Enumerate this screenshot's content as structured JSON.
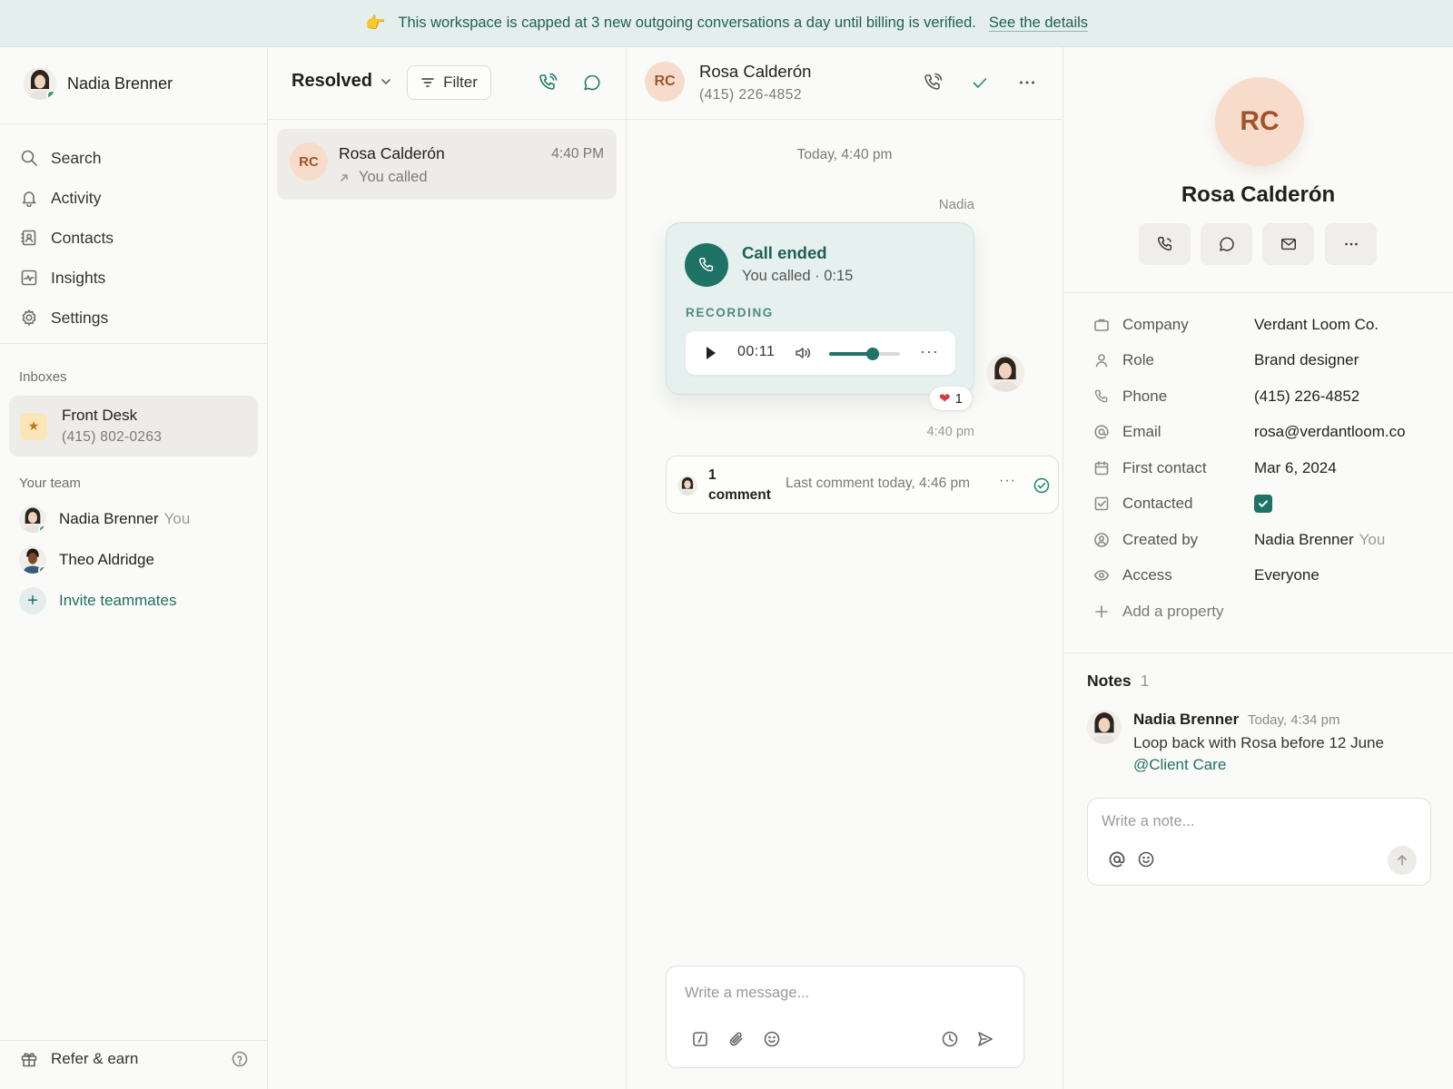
{
  "banner": {
    "emoji": "👉",
    "message": "This workspace is capped at 3 new outgoing conversations a day until billing is verified.",
    "link": "See the details"
  },
  "sidebar": {
    "user_name": "Nadia Brenner",
    "nav": [
      {
        "label": "Search",
        "icon": "search-icon"
      },
      {
        "label": "Activity",
        "icon": "bell-icon"
      },
      {
        "label": "Contacts",
        "icon": "contacts-icon"
      },
      {
        "label": "Insights",
        "icon": "insights-icon"
      },
      {
        "label": "Settings",
        "icon": "gear-icon"
      }
    ],
    "inboxes_label": "Inboxes",
    "inbox": {
      "name": "Front Desk",
      "phone": "(415) 802-0263"
    },
    "team_label": "Your team",
    "team": [
      {
        "name": "Nadia Brenner",
        "tag": "You"
      },
      {
        "name": "Theo Aldridge",
        "tag": ""
      }
    ],
    "invite": "Invite teammates",
    "refer": "Refer & earn"
  },
  "list": {
    "status": "Resolved",
    "filter": "Filter",
    "conversation": {
      "initials": "RC",
      "name": "Rosa Calderón",
      "time": "4:40 PM",
      "preview": "You called"
    }
  },
  "conversation": {
    "initials": "RC",
    "name": "Rosa Calderón",
    "phone": "(415) 226-4852",
    "day_label": "Today, 4:40 pm",
    "sender": "Nadia",
    "call": {
      "title": "Call ended",
      "subtitle": "You called · 0:15",
      "recording_label": "RECORDING",
      "player_time": "00:11",
      "progress": 0.62
    },
    "reaction": {
      "emoji": "❤",
      "count": "1"
    },
    "message_time": "4:40 pm",
    "comment": {
      "count": "1 comment",
      "last": "Last comment today, 4:46 pm"
    },
    "composer_placeholder": "Write a message..."
  },
  "details": {
    "initials": "RC",
    "name": "Rosa Calderón",
    "properties": [
      {
        "label": "Company",
        "value": "Verdant Loom Co.",
        "icon": "briefcase-icon"
      },
      {
        "label": "Role",
        "value": "Brand designer",
        "icon": "person-icon"
      },
      {
        "label": "Phone",
        "value": "(415) 226-4852",
        "icon": "phone-icon"
      },
      {
        "label": "Email",
        "value": "rosa@verdantloom.co",
        "icon": "at-icon"
      },
      {
        "label": "First contact",
        "value": "Mar 6, 2024",
        "icon": "calendar-icon"
      },
      {
        "label": "Contacted",
        "value": "",
        "icon": "checkbox-icon",
        "checked": true
      },
      {
        "label": "Created by",
        "value": "Nadia Brenner",
        "tag": "You",
        "icon": "user-circle-icon"
      },
      {
        "label": "Access",
        "value": "Everyone",
        "icon": "eye-icon"
      }
    ],
    "add_property": "Add a property",
    "notes_label": "Notes",
    "notes_count": "1",
    "note": {
      "author": "Nadia Brenner",
      "time": "Today, 4:34 pm",
      "text": "Loop back with Rosa before 12 June",
      "mention": "@Client Care"
    },
    "note_placeholder": "Write a note..."
  },
  "colors": {
    "accent": "#1f7266",
    "banner_bg": "#e4efed",
    "initials_bg": "#f8dccb",
    "initials_text": "#a0532b",
    "online": "#2e9e6b"
  }
}
